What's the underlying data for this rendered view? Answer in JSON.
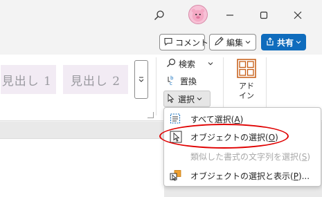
{
  "menu_items": {
    "select_all": {
      "label": "すべて選択(",
      "key": "A",
      "suffix": ")"
    },
    "select_objects": {
      "label": "オブジェクトの選択(",
      "key": "O",
      "suffix": ")"
    },
    "select_similar": {
      "label": "類似した書式の文字列を選択(",
      "key": "S",
      "suffix": ")"
    },
    "selection_pane": {
      "label": "オブジェクトの選択と表示(",
      "key": "P",
      "suffix": ")..."
    }
  },
  "action_bar": {
    "comment_label": "コメント",
    "edit_label": "編集",
    "share_label": "共有"
  },
  "ribbon": {
    "styles": [
      {
        "label": "見出し 1"
      },
      {
        "label": "見出し 2"
      }
    ],
    "editing": {
      "find_label": "検索",
      "replace_label": "置換",
      "select_label": "選択"
    },
    "addins_label_1": "アド",
    "addins_label_2": "イン"
  },
  "colors": {
    "share_button": "#0f6cbd",
    "highlight_ring": "#e00000",
    "style_gallery_bg": "#f2ebf4"
  },
  "icons": [
    "search-icon",
    "avatar-icon",
    "minimize-icon",
    "maximize-icon",
    "close-icon",
    "comment-icon",
    "pencil-icon",
    "share-icon",
    "chevron-down-icon",
    "replace-icon",
    "cursor-icon",
    "addins-icon",
    "select-all-icon",
    "select-objects-icon",
    "selection-pane-icon"
  ]
}
